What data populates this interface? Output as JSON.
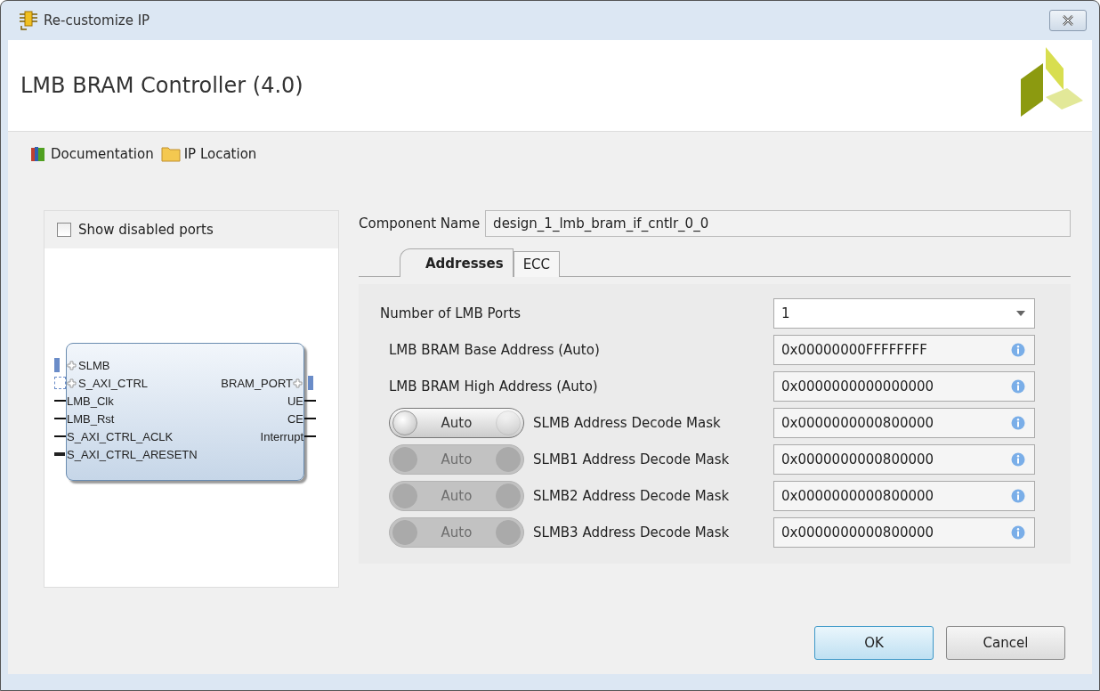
{
  "window": {
    "title": "Re-customize IP"
  },
  "header": {
    "title": "LMB BRAM Controller (4.0)"
  },
  "links": [
    {
      "kind": "book",
      "label": "Documentation"
    },
    {
      "kind": "folder",
      "label": "IP Location"
    }
  ],
  "symbol_panel": {
    "show_disabled_ports": {
      "label": "Show disabled ports",
      "checked": false
    },
    "left_ports": [
      {
        "kind": "bus",
        "name": "SLMB"
      },
      {
        "kind": "bus_dashed",
        "name": "S_AXI_CTRL"
      },
      {
        "kind": "wire",
        "name": "LMB_Clk"
      },
      {
        "kind": "wire",
        "name": "LMB_Rst"
      },
      {
        "kind": "wire",
        "name": "S_AXI_CTRL_ACLK"
      },
      {
        "kind": "reset",
        "name": "S_AXI_CTRL_ARESETN"
      }
    ],
    "right_ports": [
      {
        "kind": "bus",
        "name": "BRAM_PORT"
      },
      {
        "kind": "wire",
        "name": "UE"
      },
      {
        "kind": "wire",
        "name": "CE"
      },
      {
        "kind": "wire",
        "name": "Interrupt"
      }
    ]
  },
  "component_name": {
    "label": "Component Name",
    "value": "design_1_lmb_bram_if_cntlr_0_0"
  },
  "tabs": [
    {
      "label": "Addresses",
      "selected": true
    },
    {
      "label": "ECC",
      "selected": false
    }
  ],
  "params": [
    {
      "kind": "select",
      "label": "Number of LMB Ports",
      "value": "1"
    },
    {
      "kind": "auto",
      "label": "LMB BRAM Base Address (Auto)",
      "value": "0x00000000FFFFFFFF"
    },
    {
      "kind": "auto",
      "label": "LMB BRAM High Address (Auto)",
      "value": "0x0000000000000000"
    },
    {
      "kind": "toggle",
      "toggle_label": "Auto",
      "disabled": false,
      "label": "SLMB Address Decode Mask",
      "value": "0x0000000000800000"
    },
    {
      "kind": "toggle",
      "toggle_label": "Auto",
      "disabled": true,
      "label": "SLMB1 Address Decode Mask",
      "value": "0x0000000000800000"
    },
    {
      "kind": "toggle",
      "toggle_label": "Auto",
      "disabled": true,
      "label": "SLMB2 Address Decode Mask",
      "value": "0x0000000000800000"
    },
    {
      "kind": "toggle",
      "toggle_label": "Auto",
      "disabled": true,
      "label": "SLMB3 Address Decode Mask",
      "value": "0x0000000000800000"
    }
  ],
  "buttons": [
    {
      "label": "OK",
      "default": true
    },
    {
      "label": "Cancel",
      "default": false
    }
  ]
}
